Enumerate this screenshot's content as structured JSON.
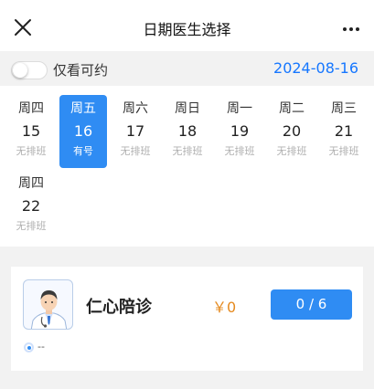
{
  "header": {
    "title": "日期医生选择",
    "close_icon": "close-icon",
    "more_icon": "more-icon"
  },
  "filter": {
    "toggle_label": "仅看可约",
    "toggle_on": false,
    "selected_date": "2024-08-16"
  },
  "calendar": {
    "days": [
      {
        "weekday": "周四",
        "day": "15",
        "status": "无排班",
        "selected": false
      },
      {
        "weekday": "周五",
        "day": "16",
        "status": "有号",
        "selected": true
      },
      {
        "weekday": "周六",
        "day": "17",
        "status": "无排班",
        "selected": false
      },
      {
        "weekday": "周日",
        "day": "18",
        "status": "无排班",
        "selected": false
      },
      {
        "weekday": "周一",
        "day": "19",
        "status": "无排班",
        "selected": false
      },
      {
        "weekday": "周二",
        "day": "20",
        "status": "无排班",
        "selected": false
      },
      {
        "weekday": "周三",
        "day": "21",
        "status": "无排班",
        "selected": false
      },
      {
        "weekday": "周四",
        "day": "22",
        "status": "无排班",
        "selected": false
      }
    ]
  },
  "doctor": {
    "name": "仁心陪诊",
    "price": "￥0",
    "slots": "0 / 6",
    "note": "--",
    "avatar_icon": "doctor-avatar-icon"
  },
  "colors": {
    "accent": "#2f8cf3",
    "date_text": "#1677ff",
    "price": "#e58a1f",
    "muted": "#b0b0b0"
  }
}
